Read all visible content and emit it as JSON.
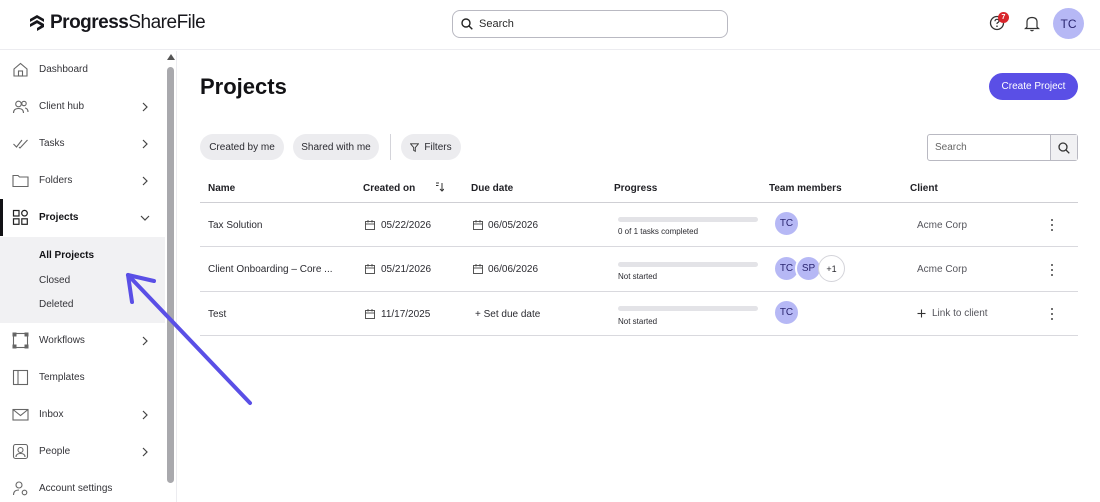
{
  "brand": {
    "name_bold": "Progress",
    "name_light": "ShareFile"
  },
  "topbar": {
    "search_placeholder": "Search",
    "help_badge": "7",
    "user_initials": "TC"
  },
  "sidebar": {
    "items": [
      {
        "label": "Dashboard",
        "icon": "home-icon"
      },
      {
        "label": "Client hub",
        "icon": "people-icon"
      },
      {
        "label": "Tasks",
        "icon": "check-icon"
      },
      {
        "label": "Folders",
        "icon": "folder-icon"
      },
      {
        "label": "Projects",
        "icon": "projects-icon"
      },
      {
        "label": "Workflows",
        "icon": "workflow-icon"
      },
      {
        "label": "Templates",
        "icon": "template-icon"
      },
      {
        "label": "Inbox",
        "icon": "mail-icon"
      },
      {
        "label": "People",
        "icon": "person-icon"
      },
      {
        "label": "Account settings",
        "icon": "settings-icon"
      }
    ],
    "sub_items": [
      "All Projects",
      "Closed",
      "Deleted"
    ]
  },
  "page": {
    "title": "Projects",
    "create_button": "Create Project",
    "filters": {
      "created_by_me": "Created by me",
      "shared_with_me": "Shared with me",
      "filters": "Filters"
    },
    "search_placeholder": "Search"
  },
  "table": {
    "headers": [
      "Name",
      "Created on",
      "Due date",
      "Progress",
      "Team members",
      "Client"
    ],
    "rows": [
      {
        "name": "Tax Solution",
        "created_on": "05/22/2026",
        "due_date": "06/05/2026",
        "progress_text": "0 of 1 tasks completed",
        "progress_fraction": 0,
        "members": [
          "TC"
        ],
        "client": "Acme Corp"
      },
      {
        "name": "Client Onboarding – Core ...",
        "created_on": "05/21/2026",
        "due_date": "06/06/2026",
        "progress_text": "Not started",
        "progress_fraction": 0,
        "members": [
          "TC",
          "SP"
        ],
        "members_more": "+1",
        "client": "Acme Corp"
      },
      {
        "name": "Test",
        "created_on": "11/17/2025",
        "due_date": "+ Set due date",
        "progress_text": "Not started",
        "progress_fraction": 0,
        "members": [
          "TC"
        ],
        "client_action": "Link to client"
      }
    ]
  },
  "colors": {
    "accent": "#5a4fe6",
    "avatar": "#b6b8f5",
    "badge": "#d8262c"
  }
}
